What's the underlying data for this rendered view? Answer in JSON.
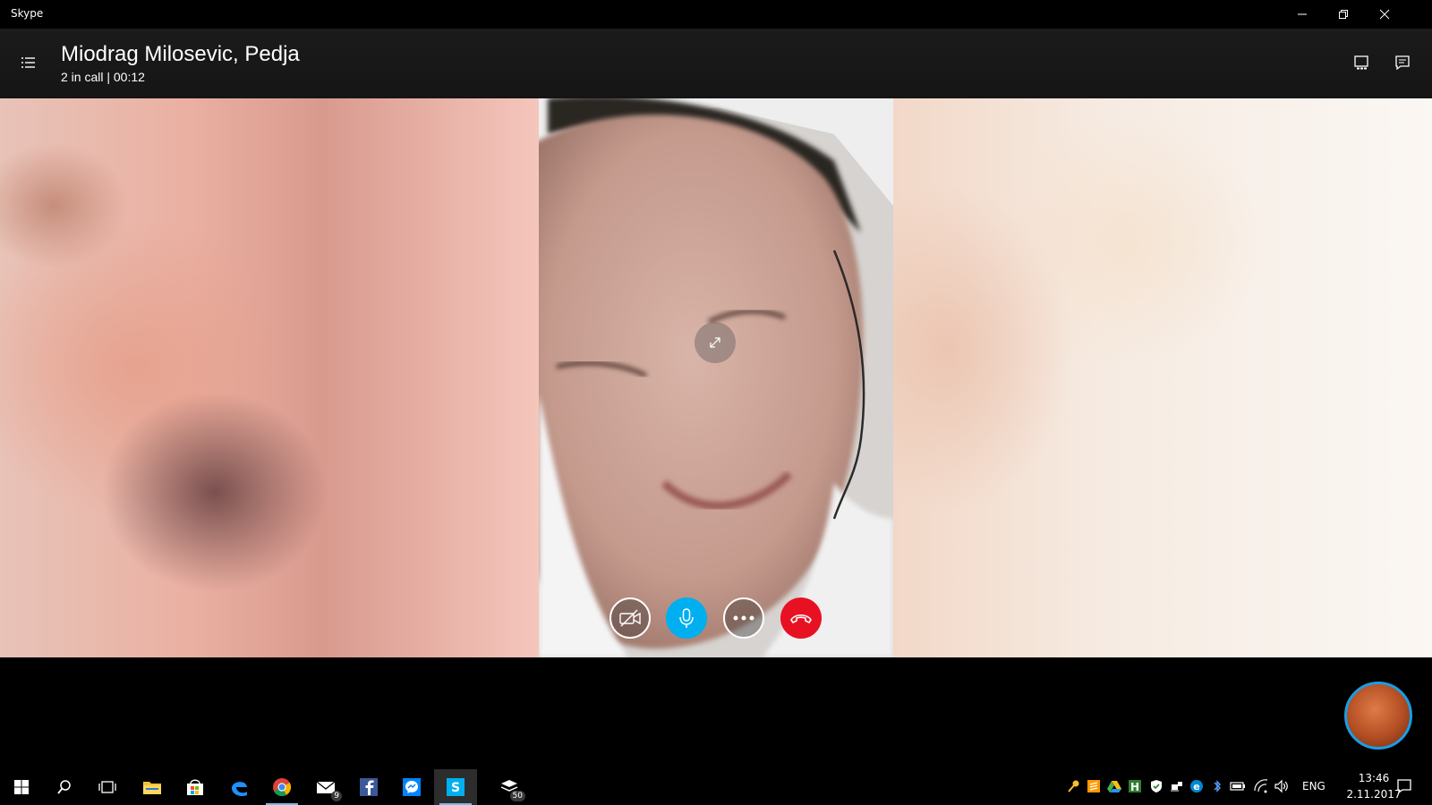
{
  "window": {
    "app_title": "Skype",
    "controls": {
      "minimize": "minimize-icon",
      "restore": "restore-icon",
      "close": "close-icon"
    }
  },
  "call": {
    "title": "Miodrag Milosevic, Pedja",
    "status": "2 in call | 00:12",
    "header_buttons": [
      "layout-icon",
      "chat-icon"
    ]
  },
  "controls": {
    "video": "video-off-icon",
    "mic": "microphone-icon",
    "more": "more-icon",
    "end": "hang-up-icon"
  },
  "colors": {
    "accent_blue": "#00aff0",
    "end_call_red": "#e81123",
    "self_view_border": "#1a9ee6"
  },
  "taskbar": {
    "apps": [
      {
        "name": "start",
        "icon": "windows-icon"
      },
      {
        "name": "search",
        "icon": "search-icon"
      },
      {
        "name": "task-view",
        "icon": "task-view-icon"
      },
      {
        "name": "file-explorer",
        "icon": "folder-icon"
      },
      {
        "name": "store",
        "icon": "store-icon"
      },
      {
        "name": "edge",
        "icon": "edge-icon"
      },
      {
        "name": "chrome",
        "icon": "chrome-icon"
      },
      {
        "name": "mail",
        "icon": "mail-icon",
        "badge": "9"
      },
      {
        "name": "facebook",
        "icon": "facebook-icon"
      },
      {
        "name": "messenger",
        "icon": "messenger-icon"
      },
      {
        "name": "skype",
        "icon": "skype-icon"
      },
      {
        "name": "other",
        "icon": "stack-icon",
        "badge": "50"
      }
    ],
    "tray": {
      "language": "ENG",
      "time": "13:46",
      "date": "2.11.2017"
    }
  }
}
